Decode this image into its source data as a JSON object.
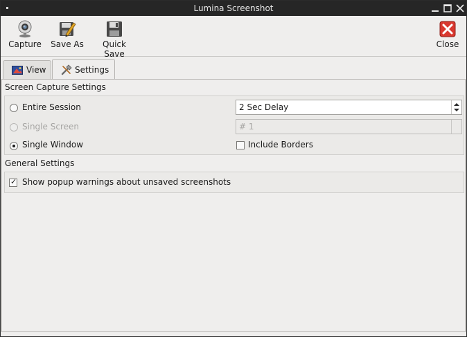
{
  "window": {
    "title": "Lumina Screenshot"
  },
  "toolbar": {
    "capture": {
      "label": "Capture",
      "icon": "webcam-icon"
    },
    "save_as": {
      "label": "Save As",
      "icon": "save-as-icon"
    },
    "quick_save": {
      "label": "Quick Save",
      "icon": "floppy-icon"
    },
    "close": {
      "label": "Close",
      "icon": "close-icon"
    }
  },
  "tabs": [
    {
      "label": "View",
      "icon": "image-icon",
      "active": false
    },
    {
      "label": "Settings",
      "icon": "tools-icon",
      "active": true
    }
  ],
  "screen_capture": {
    "title": "Screen Capture Settings",
    "entire_session": {
      "label": "Entire Session",
      "checked": false
    },
    "single_screen": {
      "label": "Single Screen",
      "checked": false,
      "disabled": true
    },
    "single_window": {
      "label": "Single Window",
      "checked": true
    },
    "delay": {
      "value": "2 Sec Delay"
    },
    "screen_number": {
      "value": "# 1",
      "disabled": true
    },
    "include_borders": {
      "label": "Include Borders",
      "checked": false
    }
  },
  "general": {
    "title": "General Settings",
    "popup_warnings": {
      "label": "Show popup warnings about unsaved screenshots",
      "checked": true
    }
  },
  "colors": {
    "titlebar": "#262626",
    "background": "#efeeed",
    "close_red": "#d9382f"
  }
}
